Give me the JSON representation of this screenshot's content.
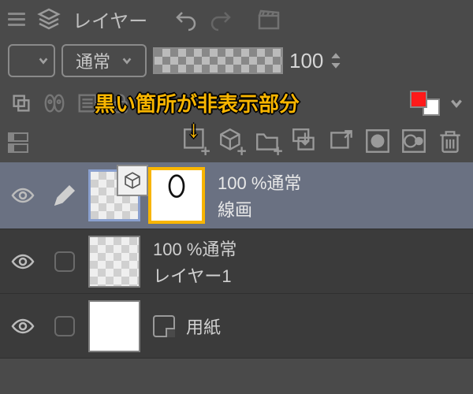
{
  "panel": {
    "title": "レイヤー"
  },
  "blend": {
    "mode": "通常"
  },
  "opacity": {
    "value": "100"
  },
  "colors": {
    "foreground": "#ff1a1a",
    "background": "#ffffff"
  },
  "annotation": {
    "text": "黒い箇所が非表示部分",
    "arrow": "↓"
  },
  "layers": [
    {
      "opacity_label": "100 %通常",
      "name": "線画"
    },
    {
      "opacity_label": "100 %通常",
      "name": "レイヤー1"
    },
    {
      "opacity_label": "",
      "name": "用紙"
    }
  ]
}
